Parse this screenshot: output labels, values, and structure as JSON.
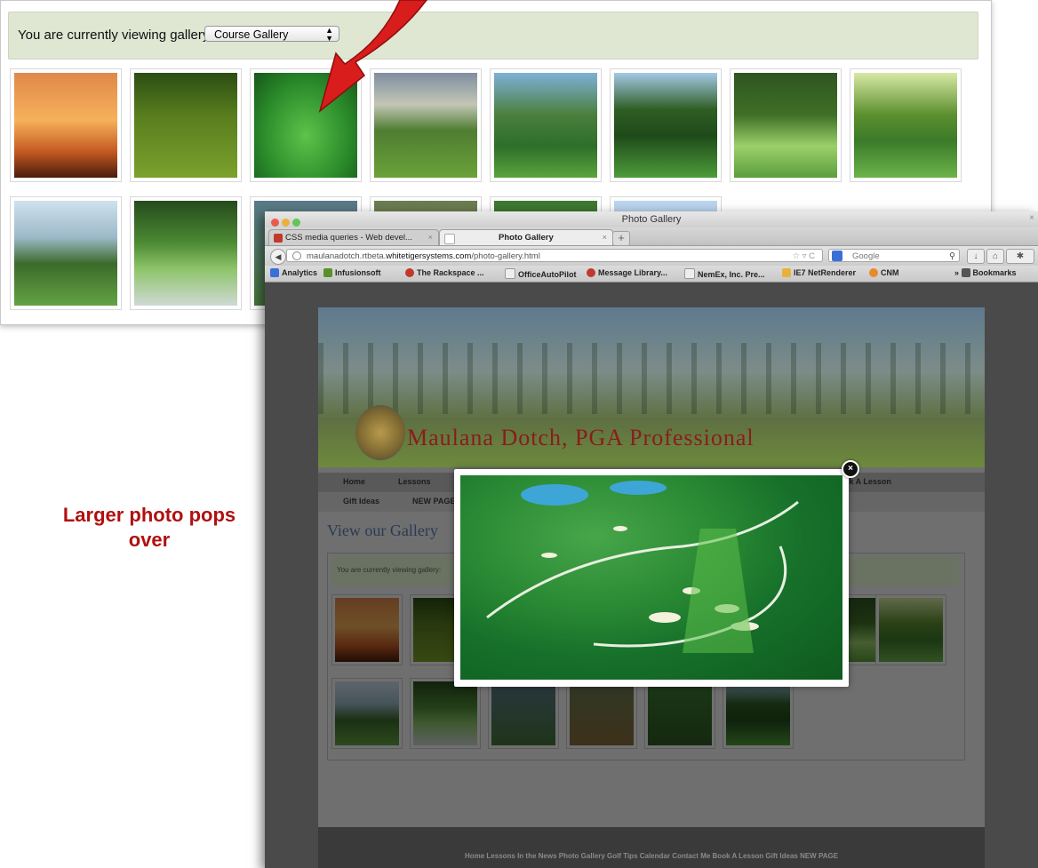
{
  "gallery": {
    "label": "You are currently viewing gallery:",
    "selected": "Course Gallery"
  },
  "annotation": "Larger photo pops over",
  "browser": {
    "window_title": "Photo Gallery",
    "tabs": [
      "CSS media queries - Web devel...",
      "Photo Gallery"
    ],
    "url_prefix": "maulanadotch.rtbeta.",
    "url_domain": "whitetigersystems.com",
    "url_path": "/photo-gallery.html",
    "search_placeholder": "Google",
    "bookmarks": [
      "Analytics",
      "Infusionsoft",
      "The Rackspace ...",
      "OfficeAutoPilot",
      "Message Library...",
      "NemEx, Inc. Pre...",
      "IE7 NetRenderer",
      "CNM"
    ],
    "bookmarks_folder": "Bookmarks"
  },
  "site": {
    "name": "Maulana Dotch, PGA Professional",
    "nav_row1": [
      "Home",
      "Lessons",
      "ok A Lesson"
    ],
    "nav_row2": [
      "Gift Ideas",
      "NEW PAGE"
    ],
    "page_title": "View our Gallery",
    "inner_label": "You are currently viewing gallery:",
    "footer_links": "Home  Lessons  In the News  Photo Gallery  Golf Tips  Calendar  Contact Me  Book A Lesson  Gift Ideas  NEW PAGE"
  },
  "colors": {
    "annotation": "#b01010",
    "site_name": "#8a1c1c",
    "gallery_bar": "#dfe6d2"
  }
}
